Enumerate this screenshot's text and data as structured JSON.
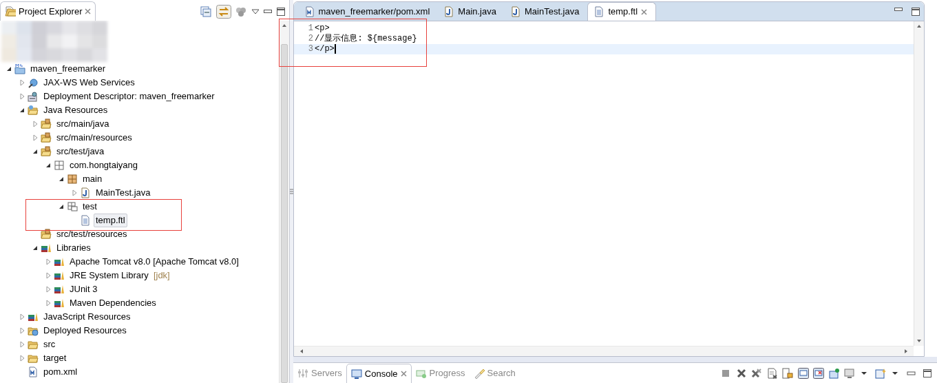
{
  "explorer": {
    "title": "Project Explorer",
    "tree": [
      {
        "label": "maven_freemarker",
        "kind": "project",
        "expanded": true,
        "selected": false,
        "children": [
          {
            "label": "JAX-WS Web Services",
            "kind": "webservice",
            "expanded": false,
            "selected": false
          },
          {
            "label": "Deployment Descriptor: maven_freemarker",
            "kind": "descriptor",
            "expanded": false,
            "selected": false
          },
          {
            "label": "Java Resources",
            "kind": "resources",
            "expanded": true,
            "selected": false,
            "children": [
              {
                "label": "src/main/java",
                "kind": "sourcefolder",
                "expanded": false,
                "selected": false
              },
              {
                "label": "src/main/resources",
                "kind": "sourcefolder",
                "expanded": false,
                "selected": false
              },
              {
                "label": "src/test/java",
                "kind": "sourcefolder",
                "expanded": true,
                "selected": false,
                "children": [
                  {
                    "label": "com.hongtaiyang",
                    "kind": "emptypackage",
                    "expanded": true,
                    "selected": false,
                    "children": [
                      {
                        "label": "main",
                        "kind": "package",
                        "expanded": true,
                        "selected": false,
                        "children": [
                          {
                            "label": "MainTest.java",
                            "kind": "java",
                            "expanded": false,
                            "selected": false
                          }
                        ]
                      },
                      {
                        "label": "test",
                        "kind": "resourcepackage",
                        "expanded": true,
                        "selected": false,
                        "children": [
                          {
                            "label": "temp.ftl",
                            "kind": "file",
                            "selected": true
                          }
                        ]
                      }
                    ]
                  }
                ]
              },
              {
                "label": "src/test/resources",
                "kind": "sourcefolder",
                "selected": false
              },
              {
                "label": "Libraries",
                "kind": "library",
                "expanded": true,
                "selected": false,
                "children": [
                  {
                    "label": "Apache Tomcat v8.0 [Apache Tomcat v8.0]",
                    "kind": "library",
                    "expanded": false,
                    "selected": false
                  },
                  {
                    "label": "JRE System Library",
                    "decoration": "[jdk]",
                    "kind": "library",
                    "expanded": false,
                    "selected": false
                  },
                  {
                    "label": "JUnit 3",
                    "kind": "library",
                    "expanded": false,
                    "selected": false
                  },
                  {
                    "label": "Maven Dependencies",
                    "kind": "library",
                    "expanded": false,
                    "selected": false
                  }
                ]
              }
            ]
          },
          {
            "label": "JavaScript Resources",
            "kind": "library",
            "expanded": false,
            "selected": false
          },
          {
            "label": "Deployed Resources",
            "kind": "deployed",
            "expanded": false,
            "selected": false
          },
          {
            "label": "src",
            "kind": "folder",
            "expanded": false,
            "selected": false
          },
          {
            "label": "target",
            "kind": "folder",
            "expanded": false,
            "selected": false
          },
          {
            "label": "pom.xml",
            "kind": "xml",
            "selected": false
          }
        ]
      }
    ]
  },
  "editor": {
    "tabs": [
      {
        "label": "maven_freemarker/pom.xml",
        "kind": "xml",
        "selected": false
      },
      {
        "label": "Main.java",
        "kind": "java",
        "selected": false
      },
      {
        "label": "MainTest.java",
        "kind": "java",
        "selected": false
      },
      {
        "label": "temp.ftl",
        "kind": "file",
        "selected": true
      }
    ],
    "lines": [
      {
        "number": "1",
        "text": "<p>",
        "current": false
      },
      {
        "number": "2",
        "text": "//显示信息: ${message}",
        "current": false
      },
      {
        "number": "3",
        "text": "</p>",
        "current": true
      }
    ]
  },
  "bottom_panel": {
    "tabs": [
      {
        "label": "Servers",
        "kind": "servers",
        "selected": false
      },
      {
        "label": "Console",
        "kind": "console",
        "selected": true
      },
      {
        "label": "Progress",
        "kind": "progress",
        "selected": false
      },
      {
        "label": "Search",
        "kind": "search",
        "selected": false
      }
    ]
  }
}
